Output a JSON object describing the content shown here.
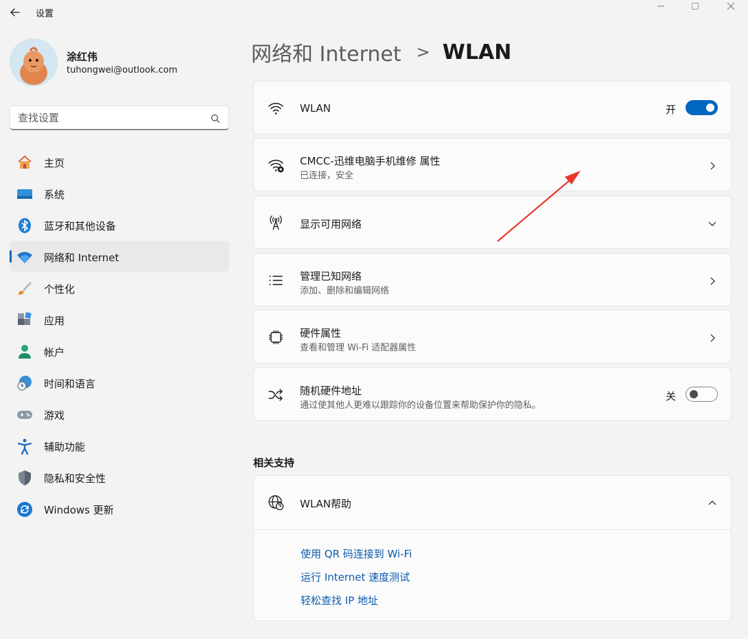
{
  "window": {
    "title": "设置"
  },
  "user": {
    "name": "涂红伟",
    "email": "tuhongwei@outlook.com"
  },
  "search": {
    "placeholder": "查找设置"
  },
  "nav": {
    "items": [
      {
        "label": "主页",
        "icon": "home-icon"
      },
      {
        "label": "系统",
        "icon": "system-icon"
      },
      {
        "label": "蓝牙和其他设备",
        "icon": "bluetooth-icon"
      },
      {
        "label": "网络和 Internet",
        "icon": "network-icon",
        "active": true
      },
      {
        "label": "个性化",
        "icon": "brush-icon"
      },
      {
        "label": "应用",
        "icon": "apps-icon"
      },
      {
        "label": "帐户",
        "icon": "account-icon"
      },
      {
        "label": "时间和语言",
        "icon": "time-language-icon"
      },
      {
        "label": "游戏",
        "icon": "gamepad-icon"
      },
      {
        "label": "辅助功能",
        "icon": "accessibility-icon"
      },
      {
        "label": "隐私和安全性",
        "icon": "shield-icon"
      },
      {
        "label": "Windows 更新",
        "icon": "update-icon"
      }
    ]
  },
  "header": {
    "parent": "网络和 Internet",
    "separator": ">",
    "current": "WLAN"
  },
  "cards": {
    "wlan": {
      "title": "WLAN",
      "toggle_label": "开",
      "toggle_on": true
    },
    "network": {
      "title": "CMCC-迅维电脑手机维修 属性",
      "subtitle": "已连接，安全"
    },
    "available": {
      "title": "显示可用网络"
    },
    "known": {
      "title": "管理已知网络",
      "subtitle": "添加、删除和编辑网络"
    },
    "hardware": {
      "title": "硬件属性",
      "subtitle": "查看和管理 Wi-Fi 适配器属性"
    },
    "random_mac": {
      "title": "随机硬件地址",
      "subtitle": "通过使其他人更难以跟踪你的设备位置来帮助保护你的隐私。",
      "toggle_label": "关",
      "toggle_on": false
    }
  },
  "related": {
    "title": "相关支持",
    "help_title": "WLAN帮助",
    "links": [
      "使用 QR 码连接到 Wi-Fi",
      "运行 Internet 速度测试",
      "轻松查找 IP 地址"
    ]
  },
  "colors": {
    "accent": "#0067c0",
    "link": "#0b5cad",
    "annotation_arrow": "#e8372b"
  }
}
